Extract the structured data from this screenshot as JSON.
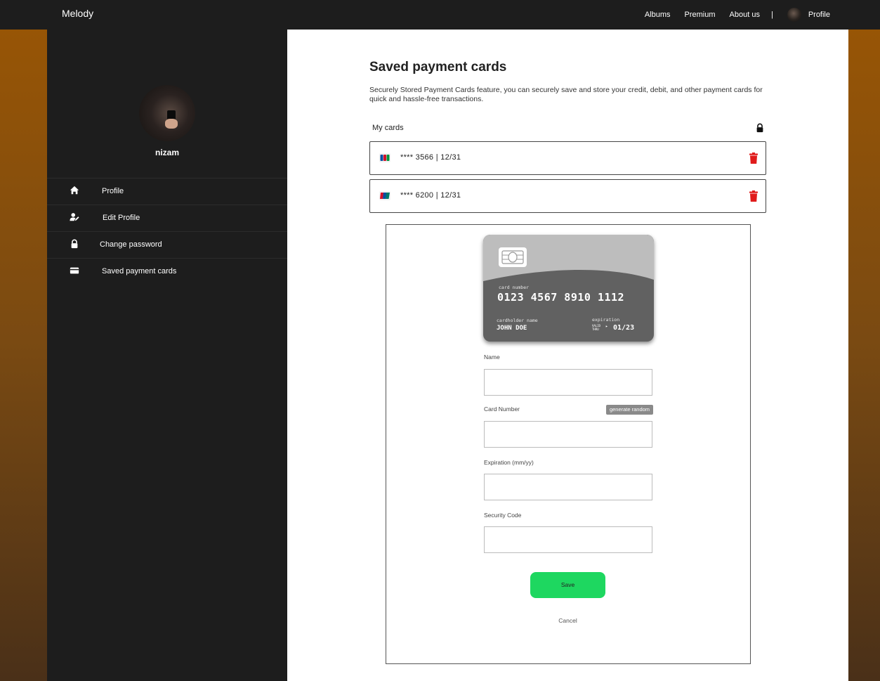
{
  "app": {
    "brand": "Melody"
  },
  "navbar": {
    "links": [
      "Albums",
      "Premium",
      "About us"
    ],
    "separator": "|",
    "profile_label": "Profile",
    "avatar_icon": "user-avatar"
  },
  "sidebar": {
    "username": "nizam",
    "items": [
      {
        "label": "Profile",
        "icon": "home-icon"
      },
      {
        "label": "Edit Profile",
        "icon": "user-edit-icon"
      },
      {
        "label": "Change password",
        "icon": "lock-icon"
      },
      {
        "label": "Saved payment cards",
        "icon": "credit-card-icon"
      }
    ]
  },
  "main": {
    "title": "Saved payment cards",
    "description": "Securely Stored Payment Cards feature, you can securely save and store your credit, debit, and other payment cards for quick and hassle-free transactions.",
    "my_cards_label": "My cards",
    "cards": [
      {
        "masked": "**** 3566",
        "separator": "|",
        "expiry": "12/31",
        "brand_icon": "jcb-icon"
      },
      {
        "masked": "**** 6200",
        "separator": "|",
        "expiry": "12/31",
        "brand_icon": "unionpay-icon"
      }
    ]
  },
  "card_preview": {
    "number_label": "card number",
    "number": "0123 4567 8910 1112",
    "holder_label": "cardholder name",
    "holder": "JOHN DOE",
    "expiration_label": "expiration",
    "valid_thru": "VALID THRU",
    "expiration": "01/23"
  },
  "form": {
    "name_label": "Name",
    "card_number_label": "Card Number",
    "generate_label": "generate random",
    "expiration_label": "Expiration (mm/yy)",
    "security_label": "Security Code",
    "name_value": "",
    "card_number_value": "",
    "expiration_value": "",
    "security_value": "",
    "save_label": "Save",
    "cancel_label": "Cancel"
  },
  "colors": {
    "navbar_bg": "#1d1d1d",
    "save_green": "#1ed760",
    "delete_red": "#e01b1b",
    "background_orange": "#9a5604"
  }
}
